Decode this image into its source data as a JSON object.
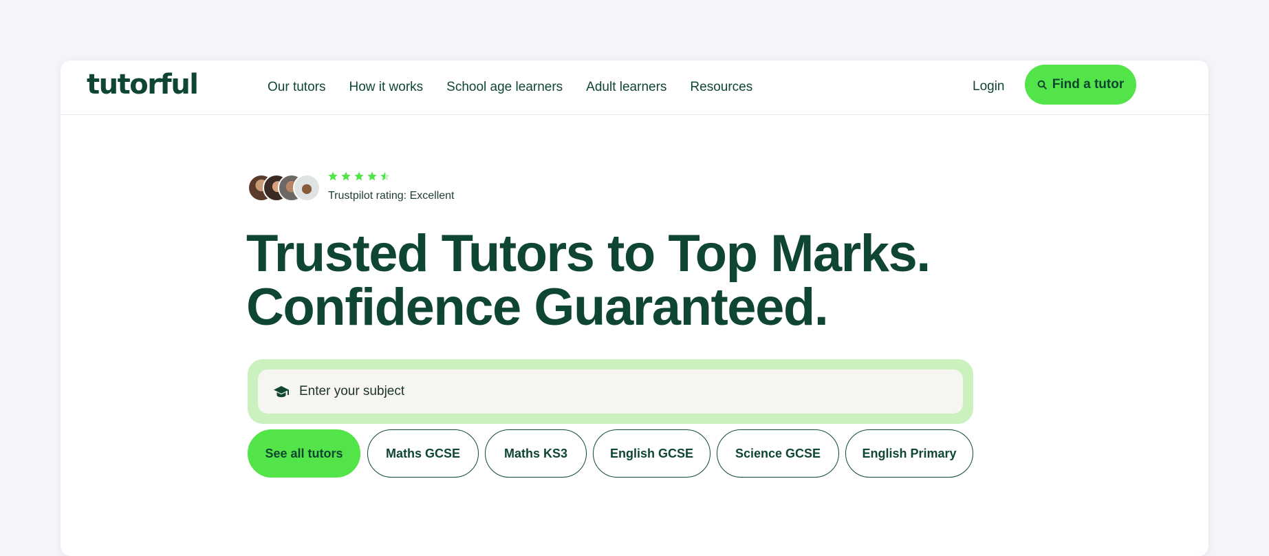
{
  "header": {
    "logo": "tutorful",
    "nav": [
      "Our tutors",
      "How it works",
      "School age learners",
      "Adult learners",
      "Resources"
    ],
    "login": "Login",
    "cta": "Find a tutor"
  },
  "rating": {
    "stars": 4.5,
    "text": "Trustpilot rating: Excellent"
  },
  "hero": {
    "headline_line1": "Trusted Tutors to Top Marks.",
    "headline_line2": "Confidence Guaranteed."
  },
  "search": {
    "placeholder": "Enter your subject"
  },
  "chips": [
    "See all tutors",
    "Maths GCSE",
    "Maths KS3",
    "English GCSE",
    "Science GCSE",
    "English Primary"
  ],
  "colors": {
    "brand_dark": "#0e4632",
    "brand_green": "#52e449",
    "search_outline": "#cbf1bf",
    "page_bg": "#f3f5f9"
  },
  "icons": [
    "search-icon",
    "graduation-cap-icon",
    "star-icon",
    "half-star-icon"
  ]
}
